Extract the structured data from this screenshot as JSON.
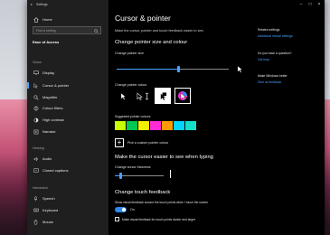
{
  "window": {
    "title": "Settings"
  },
  "sidebar": {
    "home_label": "Home",
    "search_placeholder": "Find a setting",
    "section_title": "Ease of Access",
    "groups": {
      "vision": "Vision",
      "hearing": "Hearing",
      "interaction": "Interaction"
    },
    "items": {
      "display": "Display",
      "cursor": "Cursor & pointer",
      "magnifier": "Magnifier",
      "colour_filters": "Colour filters",
      "high_contrast": "High contrast",
      "narrator": "Narrator",
      "audio": "Audio",
      "closed_captions": "Closed captions",
      "speech": "Speech",
      "keyboard": "Keyboard",
      "mouse": "Mouse"
    }
  },
  "main": {
    "page_title": "Cursor & pointer",
    "subtitle": "Make the cursor, pointer and touch feedback easier to see.",
    "size_heading": "Change pointer size and colour",
    "size_label": "Change pointer size",
    "pointer_size_value": 0.55,
    "colour_label": "Change pointer colour",
    "suggested_label": "Suggested pointer colours",
    "custom_label": "Pick a custom pointer colour",
    "cursor_heading": "Make the cursor easier to see when typing",
    "thickness_label": "Change cursor thickness",
    "cursor_thickness_value": 0.12,
    "touch_heading": "Change touch feedback",
    "touch_toggle_label": "Show visual feedback around the touch points when I touch the screen",
    "toggle_state": "On",
    "checkbox_label": "Make visual feedback for touch points darker and larger"
  },
  "right": {
    "related_title": "Related settings",
    "related_link": "Additional mouse settings",
    "question_title": "Do you have a question?",
    "question_link": "Get help",
    "better_title": "Make Windows better",
    "better_link": "Give us feedback"
  },
  "colors": {
    "accent": "#4aa3ff",
    "swatches": [
      "#c8ff00",
      "#00c853",
      "#f5f000",
      "#ff2bd6",
      "#ff9a00",
      "#00d4ff",
      "#14e0c8"
    ]
  }
}
